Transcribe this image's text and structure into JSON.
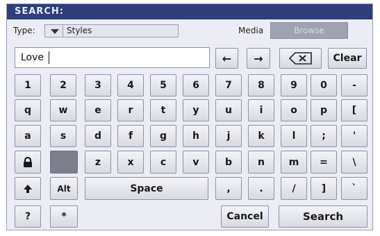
{
  "title": "SEARCH:",
  "type_label": "Type:",
  "type_value": "Styles",
  "media_label": "Media",
  "browse_label": "Browse",
  "search_value": "Love",
  "nav": {
    "left": "←",
    "right": "→",
    "clear": "Clear"
  },
  "rows": [
    [
      "1",
      "2",
      "3",
      "4",
      "5",
      "6",
      "7",
      "8",
      "9",
      "0",
      "-"
    ],
    [
      "q",
      "w",
      "e",
      "r",
      "t",
      "y",
      "u",
      "i",
      "o",
      "p",
      "["
    ],
    [
      "a",
      "s",
      "d",
      "f",
      "g",
      "h",
      "j",
      "k",
      "l",
      ";",
      "'"
    ]
  ],
  "row4": [
    "z",
    "x",
    "c",
    "v",
    "b",
    "n",
    "m",
    "=",
    "\\"
  ],
  "row5": {
    "alt": "Alt",
    "space": "Space",
    "comma": ",",
    "period": ".",
    "slash": "/",
    "bracket": "]",
    "backtick": "`"
  },
  "row6": {
    "question": "?",
    "asterisk": "*",
    "cancel": "Cancel",
    "search": "Search"
  },
  "icons": {
    "lock": "lock-icon",
    "shift": "shift-up-icon",
    "backspace": "backspace-icon"
  },
  "colors": {
    "titlebar": "#2f3d79",
    "panel": "#ececf4"
  }
}
